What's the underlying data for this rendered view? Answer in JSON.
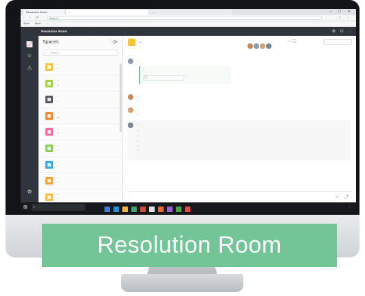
{
  "banner": {
    "text": "Resolution Room"
  },
  "browser": {
    "tabs": [
      "Resolution Room",
      "...",
      "..."
    ],
    "window_controls": "– ☐ ✕",
    "nav": "‹ › ⟳",
    "url": "https://...",
    "addr_icons": "☆ ⋮",
    "bookmarks": [
      "Apps",
      "Apps",
      "...",
      "..."
    ]
  },
  "app": {
    "brand": "Resolution Room",
    "links": [
      "...",
      "..."
    ],
    "header_right": [
      "⚙",
      "⏻",
      "..."
    ]
  },
  "rail": {
    "icons": [
      "📈",
      "☺",
      "⚠",
      "⚙"
    ]
  },
  "list": {
    "title": "Spaces",
    "refresh_icon": "⟳",
    "search_placeholder": "Search",
    "items": [
      {
        "color": "#f5c542",
        "title": "...",
        "subtitle": "...",
        "time": "",
        "bold": false
      },
      {
        "color": "#a6d04a",
        "title": "...",
        "subtitle": "...",
        "time": "",
        "bold": true
      },
      {
        "color": "#555a60",
        "title": "...",
        "subtitle": "...",
        "time": "",
        "bold": false
      },
      {
        "color": "#f28a3a",
        "title": "...",
        "subtitle": "...",
        "time": "",
        "bold": true
      },
      {
        "color": "#f26d9a",
        "title": "...",
        "subtitle": "...",
        "time": "",
        "bold": true
      },
      {
        "color": "#8ccf5a",
        "title": "...",
        "subtitle": "...",
        "time": "",
        "bold": false
      },
      {
        "color": "#3fa7e8",
        "title": "...",
        "subtitle": "...",
        "time": "",
        "bold": false
      },
      {
        "color": "#f0a43a",
        "title": "...",
        "subtitle": "...",
        "time": "",
        "bold": false
      },
      {
        "color": "#f8c04c",
        "title": "...",
        "subtitle": "...",
        "time": "",
        "bold": false
      }
    ]
  },
  "conversation": {
    "title": "...",
    "participant_colors": [
      "#c98a5a",
      "#8a9bb0",
      "#d6a06a",
      "#7a8694"
    ],
    "tools": "⋯ ☐",
    "search_placeholder": "...",
    "date": "...",
    "messages": [
      {
        "avatar": "#8a9bb0",
        "name": "...",
        "lines": [
          "..."
        ]
      },
      {
        "avatar": "#c98a5a",
        "name": "...",
        "lines": [
          "..."
        ]
      },
      {
        "avatar": "#d6a06a",
        "name": "...",
        "lines": [
          "..."
        ]
      },
      {
        "avatar": "#7a8694",
        "name": "...",
        "lines": [
          "...",
          "...",
          "...",
          "...",
          "..."
        ]
      }
    ],
    "card_line": "...",
    "card_chip": "...",
    "reply": "...",
    "composer_placeholder": "...",
    "composer_icons": "☺ ⤴"
  },
  "taskbar": {
    "start_icon": "⊞",
    "search_placeholder": "...",
    "app_colors": [
      "#3a7bd5",
      "#2b8fd6",
      "#f0b43a",
      "#3da36a",
      "#d24b3a",
      "#e0e0e0",
      "#e56a2f",
      "#9a5fd0",
      "#4fa53a",
      "#e04a4a"
    ],
    "tray": "..."
  }
}
